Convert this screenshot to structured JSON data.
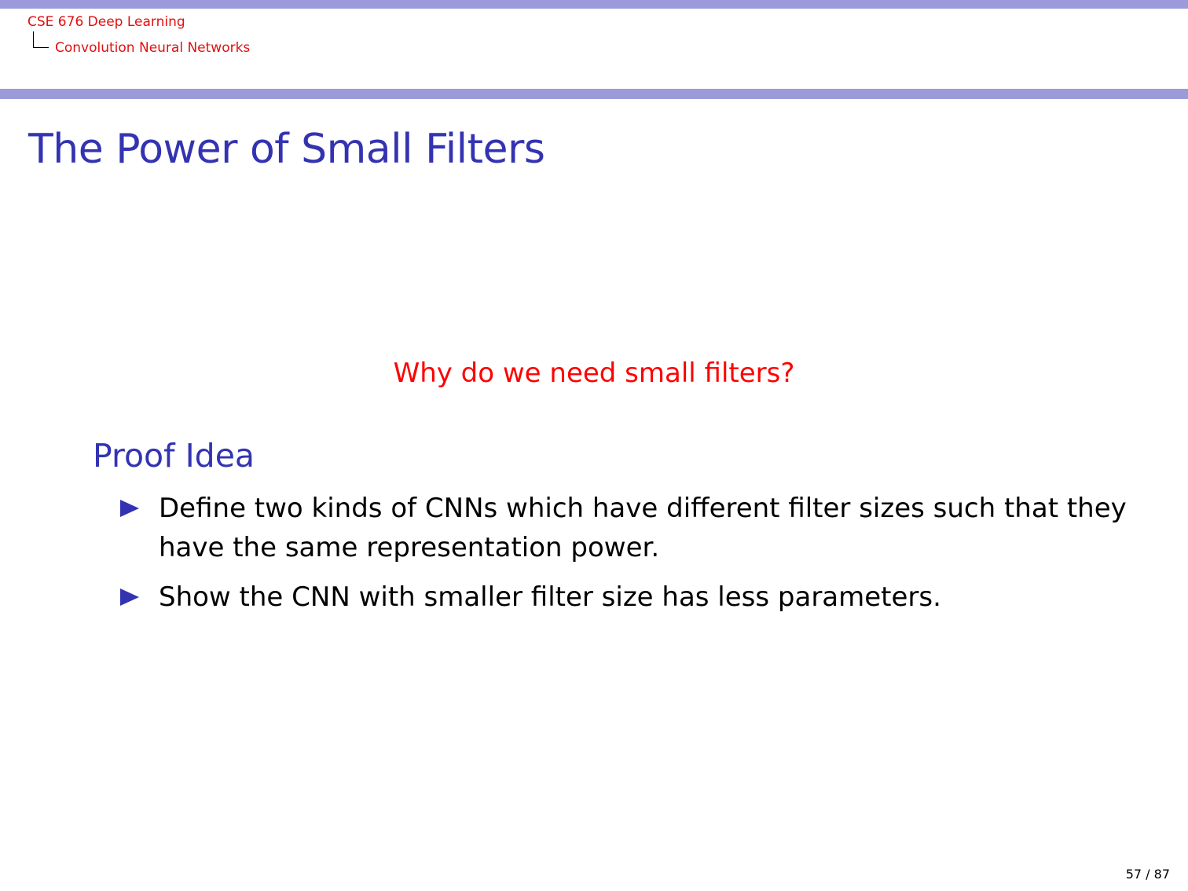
{
  "header": {
    "course_title": "CSE 676 Deep Learning",
    "section_title": "Convolution Neural Networks"
  },
  "slide": {
    "title": "The Power of Small Filters",
    "question": "Why do we need small filters?",
    "block": {
      "title": "Proof Idea",
      "bullets": [
        {
          "text": "Define two kinds of CNNs which have different filter sizes such that they have the same representation power."
        },
        {
          "text": "Show the CNN with smaller filter size has less parameters."
        }
      ]
    }
  },
  "footer": {
    "page_number": "57 / 87"
  },
  "colors": {
    "bar": "#9b9bdc",
    "title_blue": "#3333b2",
    "header_red": "#e01010",
    "question_red": "#ff0000"
  },
  "icons": {
    "bullet": "triangle-right-icon",
    "tree_connector": "tree-corner-icon"
  }
}
